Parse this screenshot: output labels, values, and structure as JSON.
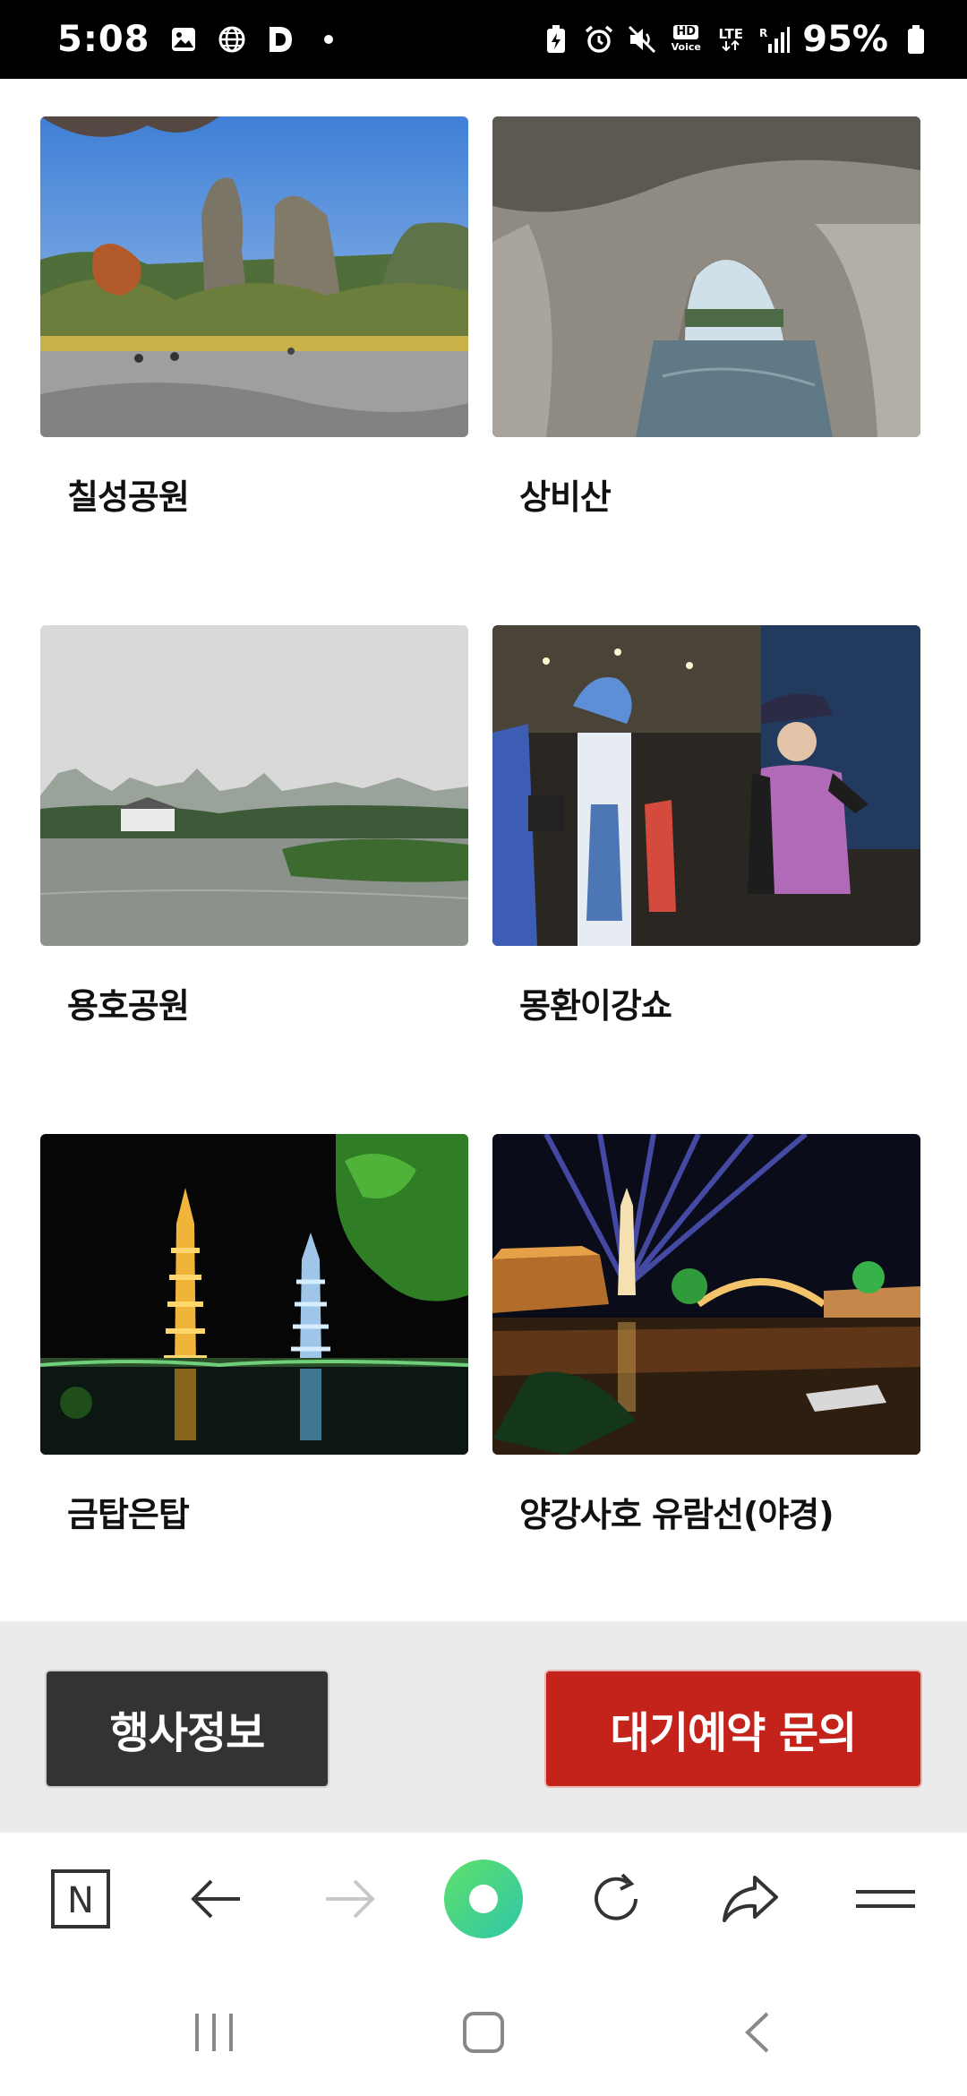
{
  "status_bar": {
    "time": "5:08",
    "left_icons": [
      "image-icon",
      "globe-icon",
      "d-app-icon",
      "dot-icon"
    ],
    "right_icons": [
      "battery-saver-icon",
      "alarm-icon",
      "mute-icon",
      "hd-voice-icon",
      "lte-icon",
      "signal-icon",
      "battery-icon"
    ],
    "hd_label": "HD",
    "voice_label": "Voice",
    "lte_label": "LTE",
    "battery": "95%"
  },
  "cards": [
    {
      "label": "칠성공원",
      "image": "karst-park-photo"
    },
    {
      "label": "상비산",
      "image": "elephant-trunk-hill-photo"
    },
    {
      "label": "용호공원",
      "image": "lake-park-photo"
    },
    {
      "label": "몽환이강쇼",
      "image": "costume-show-photo"
    },
    {
      "label": "금탑은탑",
      "image": "golden-silver-pagoda-photo"
    },
    {
      "label": "양강사호 유람선(야경)",
      "image": "night-cruise-photo"
    }
  ],
  "actions": {
    "event_info": "행사정보",
    "reservation": "대기예약 문의"
  },
  "browser": {
    "n_label": "N",
    "icons": [
      "naver-home-icon",
      "back-arrow-icon",
      "forward-arrow-icon",
      "green-dot-icon",
      "refresh-icon",
      "share-icon",
      "menu-icon"
    ]
  },
  "nav": {
    "icons": [
      "recent-apps-icon",
      "home-icon",
      "back-icon"
    ]
  },
  "colors": {
    "primary_button": "#c4231b",
    "secondary_button": "#333333",
    "action_bar_bg": "#ebebeb"
  }
}
